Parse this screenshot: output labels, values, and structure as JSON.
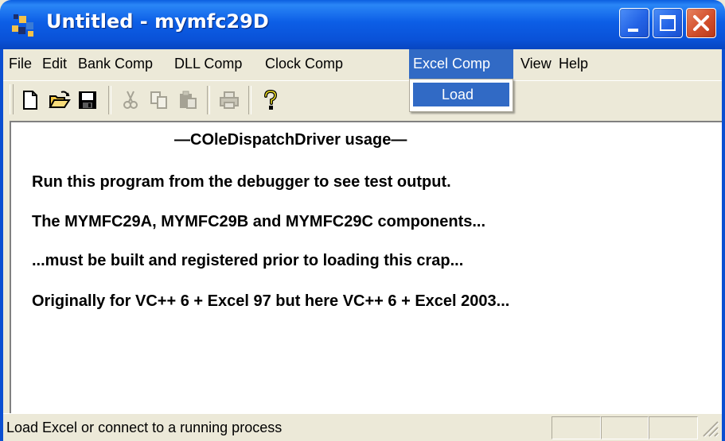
{
  "window": {
    "title": "Untitled - mymfc29D"
  },
  "menu": {
    "items": [
      "File",
      "Edit",
      "Bank Comp",
      "DLL Comp",
      "Clock Comp",
      "Excel Comp",
      "View",
      "Help"
    ],
    "active": "Excel Comp",
    "dropdown": {
      "items": [
        "Load"
      ]
    }
  },
  "toolbar": {
    "icons": [
      "new-icon",
      "open-icon",
      "save-icon",
      "cut-icon",
      "copy-icon",
      "paste-icon",
      "print-icon",
      "help-icon"
    ],
    "disabled": [
      "cut-icon",
      "copy-icon",
      "paste-icon",
      "print-icon"
    ]
  },
  "content": {
    "heading": "—COleDispatchDriver usage—",
    "lines": [
      "Run this program from the debugger to see test output.",
      "The MYMFC29A, MYMFC29B and MYMFC29C components...",
      "...must be built and registered prior to loading this crap...",
      "Originally for VC++ 6 + Excel 97 but here VC++ 6 + Excel 2003..."
    ]
  },
  "status": {
    "text": "Load Excel or connect to a running process"
  },
  "colors": {
    "titlebar": "#0a52d8",
    "menu_highlight": "#316ac5",
    "chrome": "#ece9d8",
    "close_button": "#d3502c"
  }
}
